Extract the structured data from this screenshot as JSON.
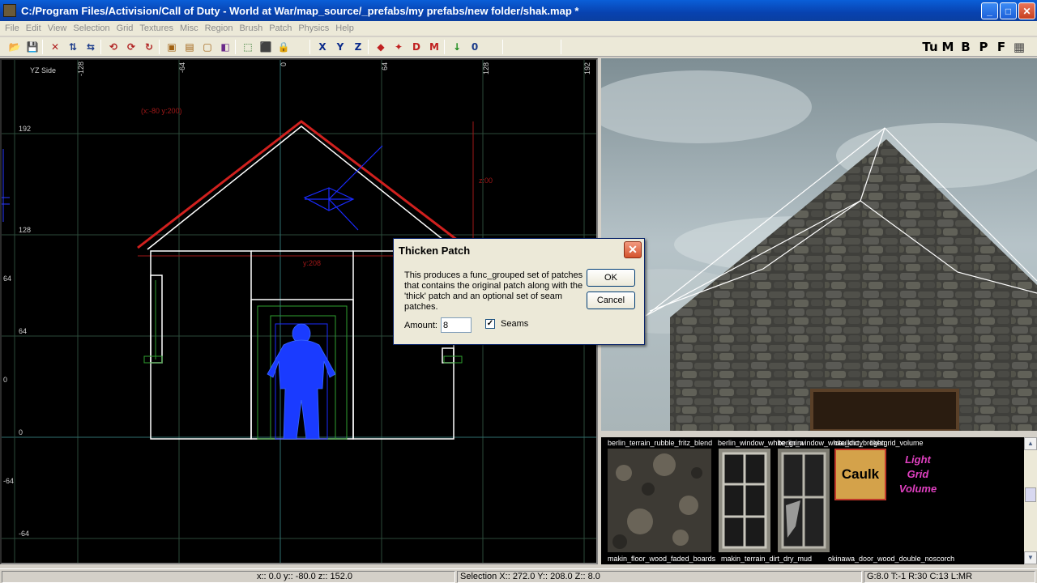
{
  "window": {
    "title": "C:/Program Files/Activision/Call of Duty - World at War/map_source/_prefabs/my prefabs/new folder/shak.map *",
    "min_icon": "_",
    "max_icon": "□",
    "close_icon": "✕"
  },
  "menu": [
    "File",
    "Edit",
    "View",
    "Selection",
    "Grid",
    "Textures",
    "Misc",
    "Region",
    "Brush",
    "Patch",
    "Physics",
    "Help"
  ],
  "toolbar_icons": [
    {
      "name": "open-icon",
      "glyph": "📂"
    },
    {
      "name": "save-icon",
      "glyph": "💾"
    },
    {
      "name": "xz-flip-icon",
      "glyph": "✕"
    },
    {
      "name": "flip-y-icon",
      "glyph": "⇅"
    },
    {
      "name": "flip-z-icon",
      "glyph": "⇆"
    },
    {
      "name": "rotate-x-icon",
      "glyph": "⟲"
    },
    {
      "name": "rotate-y-icon",
      "glyph": "⟳"
    },
    {
      "name": "rotate-z-icon",
      "glyph": "↻"
    },
    {
      "name": "csg-subtract-icon",
      "glyph": "▣"
    },
    {
      "name": "csg-merge-icon",
      "glyph": "▤"
    },
    {
      "name": "hollow-icon",
      "glyph": "▢"
    },
    {
      "name": "clipper-icon",
      "glyph": "◧"
    },
    {
      "name": "select-touching-icon",
      "glyph": "⬚"
    },
    {
      "name": "select-inside-icon",
      "glyph": "⬛"
    },
    {
      "name": "texture-lock-icon",
      "glyph": "🔒"
    },
    {
      "name": "view-x-icon",
      "glyph": "X"
    },
    {
      "name": "view-y-icon",
      "glyph": "Y"
    },
    {
      "name": "view-z-icon",
      "glyph": "Z"
    },
    {
      "name": "entity-icon",
      "glyph": "◆"
    },
    {
      "name": "lights-icon",
      "glyph": "✦"
    },
    {
      "name": "color-d-icon",
      "glyph": "D"
    },
    {
      "name": "color-m-icon",
      "glyph": "M"
    },
    {
      "name": "down-icon",
      "glyph": "↓"
    },
    {
      "name": "zero-icon",
      "glyph": "0"
    },
    {
      "name": "tu-icon",
      "glyph": "Tu"
    },
    {
      "name": "m-icon",
      "glyph": "M"
    },
    {
      "name": "b-icon",
      "glyph": "B"
    },
    {
      "name": "p-icon",
      "glyph": "P"
    },
    {
      "name": "f-icon",
      "glyph": "F"
    },
    {
      "name": "grid-icon",
      "glyph": "▦"
    }
  ],
  "ortho_view": {
    "label": "YZ Side",
    "top_ticks": [
      "-128",
      "-64",
      "0",
      "64",
      "128",
      "192"
    ],
    "left_ticks": [
      "192",
      "128",
      "64",
      "0",
      "-64"
    ],
    "far_left_ticks": [
      "64",
      "0",
      "-64"
    ],
    "coord_label_1": "(x:-80  y:200)",
    "coord_label_2": "z:00",
    "coord_label_3": "y:208"
  },
  "dialog": {
    "title": "Thicken Patch",
    "description": "This produces a func_grouped set of patches that contains the original patch along with the 'thick' patch and an optional set of seam patches.",
    "ok_label": "OK",
    "cancel_label": "Cancel",
    "amount_label": "Amount:",
    "amount_value": "8",
    "seams_label": "Seams",
    "seams_checked": true,
    "check_glyph": "✓",
    "close_glyph": "✕"
  },
  "texture_browser": {
    "top_names": [
      "berlin_terrain_rubble_fritz_blend",
      "berlin_window_white_grim",
      "berlin_window_white_dirty",
      "caulk",
      "mc_broken",
      "lightgrid_volume"
    ],
    "bottom_names": [
      "makin_floor_wood_faded_boards",
      "makin_terrain_dirt_dry_mud",
      "okinawa_door_wood_double_noscorch"
    ],
    "caulk_label": "Caulk",
    "lightgrid_label_1": "Light",
    "lightgrid_label_2": "Grid",
    "lightgrid_label_3": "Volume",
    "scroll_up": "▲",
    "scroll_down": "▼"
  },
  "status": {
    "coords": "x:: 0.0  y:: -80.0  z:: 152.0",
    "selection": "Selection X:: 272.0  Y:: 208.0  Z:: 8.0",
    "grid_info": "G:8.0 T:-1 R:30 C:13 L:MR"
  },
  "colors": {
    "title_bg": "#0842b0",
    "selected_patch": "#d0201e",
    "grid_line": "#3a5a3a",
    "axis_line": "#2f6f6f",
    "blue_brush": "#1a2bff",
    "caulk_bg": "#d4a24a",
    "lightgrid_text": "#e040c0"
  }
}
